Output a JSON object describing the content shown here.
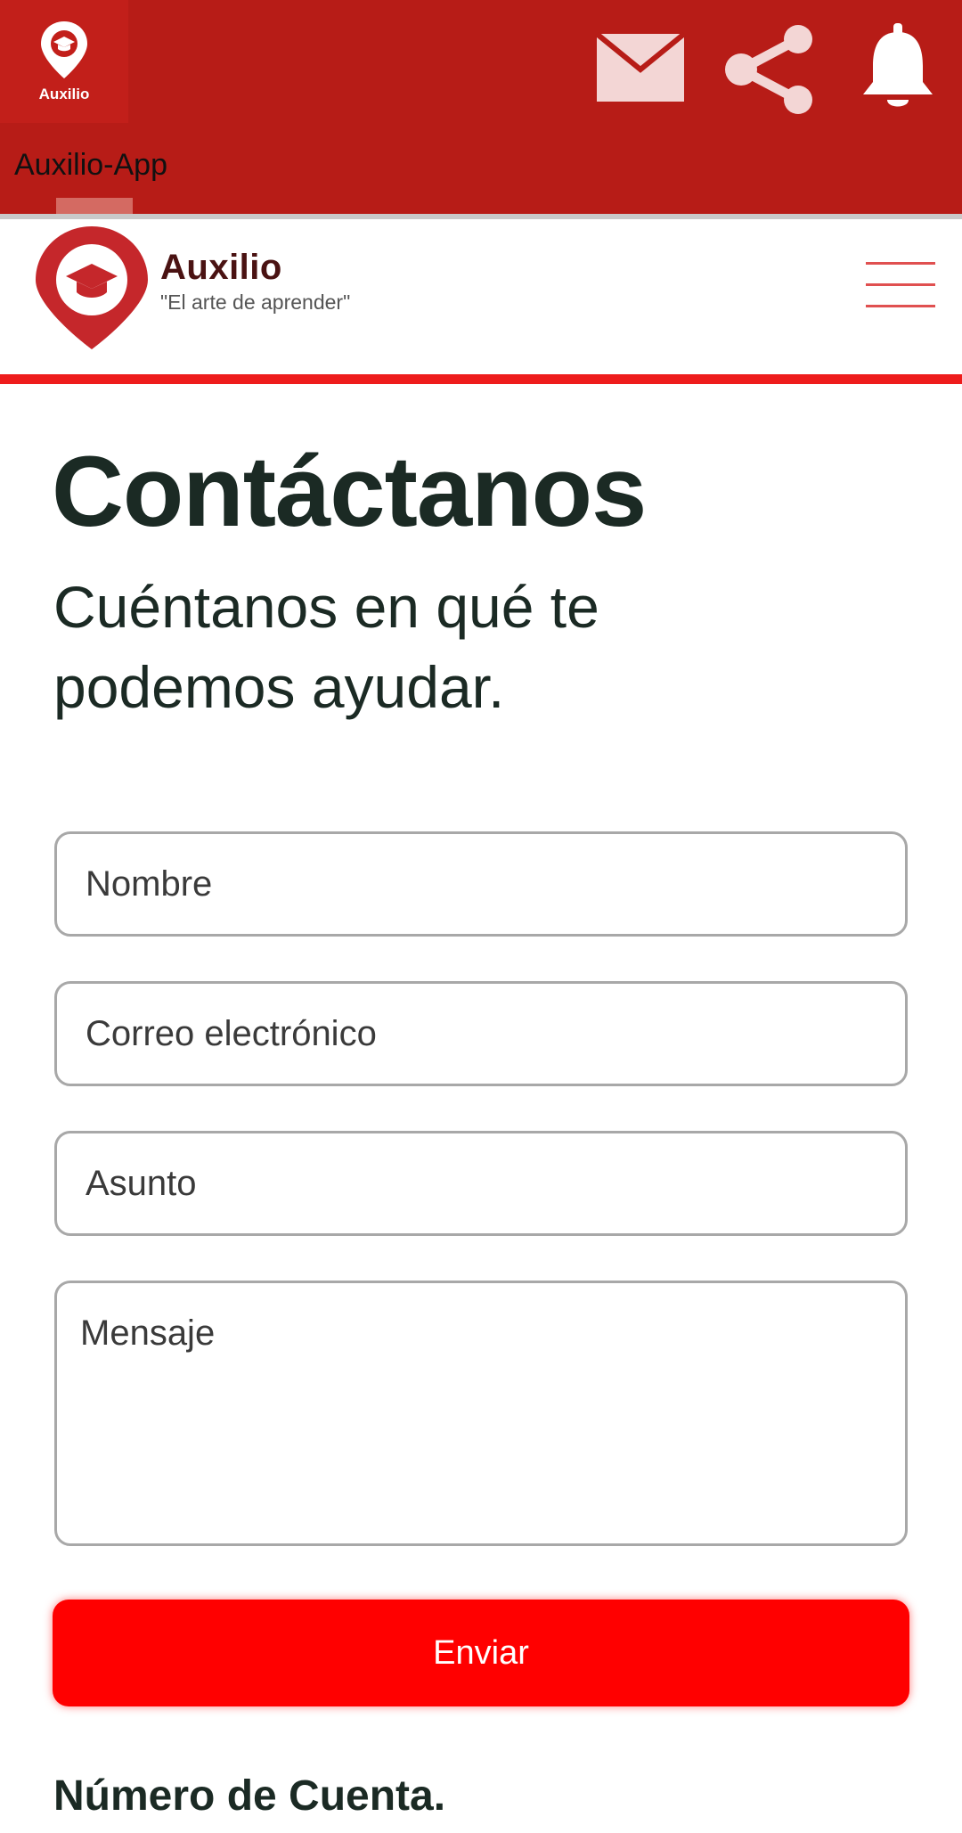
{
  "app_bar": {
    "icon_label": "Auxilio",
    "title": "Auxilio-App",
    "icons": [
      "mail-icon",
      "share-icon",
      "bell-icon"
    ],
    "background_color": "#b71c17"
  },
  "header": {
    "brand_name": "Auxilio",
    "tagline": "\"El arte de aprender\"",
    "menu_icon": "hamburger-menu-icon",
    "accent_color": "#ee1c1c"
  },
  "contact": {
    "title": "Contáctanos",
    "subtitle": "Cuéntanos en qué te podemos ayudar.",
    "fields": {
      "name_placeholder": "Nombre",
      "email_placeholder": "Correo electrónico",
      "subject_placeholder": "Asunto",
      "message_placeholder": "Mensaje"
    },
    "submit_label": "Enviar"
  },
  "account_section": {
    "heading": "Número de Cuenta."
  }
}
